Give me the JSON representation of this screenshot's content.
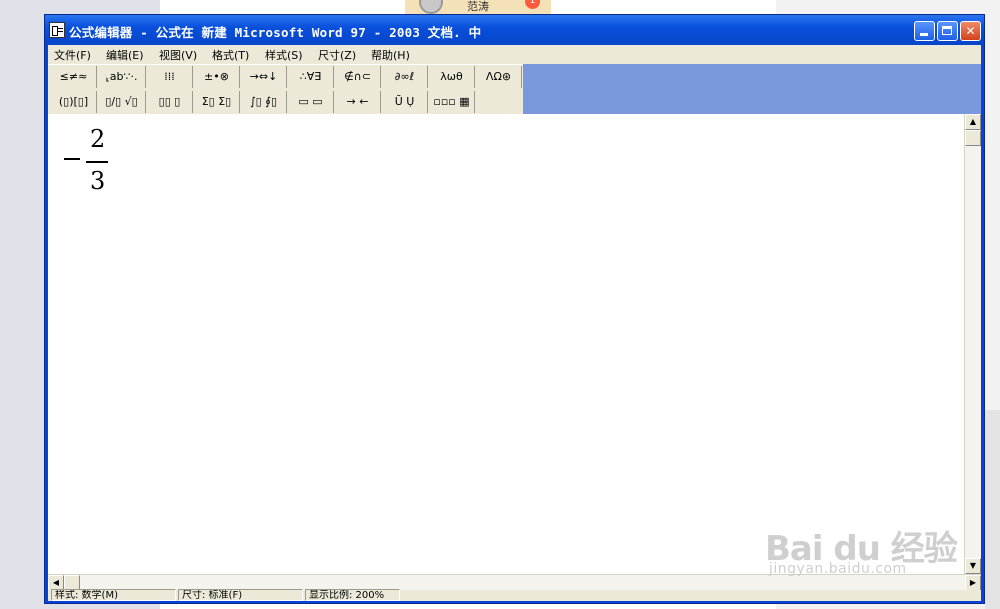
{
  "background": {
    "chip_name": "范涛",
    "chip_badge": "1"
  },
  "window": {
    "title": "公式编辑器 - 公式在 新建 Microsoft Word 97 - 2003 文档. 中",
    "buttons": {
      "minimize": "minimize",
      "maximize": "maximize",
      "close": "✕"
    }
  },
  "menu": [
    "文件(F)",
    "编辑(E)",
    "视图(V)",
    "格式(T)",
    "样式(S)",
    "尺寸(Z)",
    "帮助(H)"
  ],
  "palette": {
    "row1": [
      "≤≠≈",
      "⸤ab∵·.",
      "⁞⁞⁞",
      "±•⊗",
      "→⇔↓",
      "∴∀∃",
      "∉∩⊂",
      "∂∞ℓ",
      "λωθ",
      "ΛΩ⊛"
    ],
    "row2": [
      "(▯)[▯]",
      "▯/▯ √▯",
      "▯▯ ▯",
      "Σ▯ Σ▯",
      "∫▯ ∮▯",
      "▭ ▭",
      "→ ←",
      "Ū Ụ",
      "▫▫▫ ▦"
    ]
  },
  "equation": {
    "sign": "−",
    "numerator": "2",
    "denominator": "3"
  },
  "scrollbar": {
    "up": "▲",
    "down": "▼",
    "left": "◀",
    "right": "▶"
  },
  "status": {
    "style": "样式: 数学(M)",
    "size": "尺寸: 标准(F)",
    "zoom": "显示比例: 200%"
  },
  "watermark": {
    "brand": "Bai du 经验",
    "site": "jingyan.baidu.com"
  },
  "colors": {
    "titlebar": "#0a50dc",
    "palette_fill": "#7b98dd",
    "dialog_face": "#ece9d8"
  }
}
